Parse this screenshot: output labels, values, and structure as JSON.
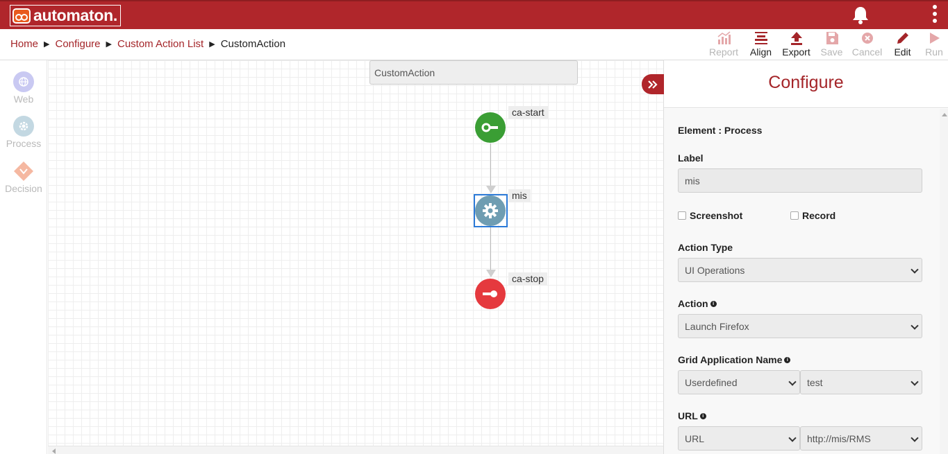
{
  "app": {
    "logo_text": "automaton."
  },
  "breadcrumb": {
    "home": "Home",
    "configure": "Configure",
    "list": "Custom Action List",
    "current": "CustomAction",
    "sep": "▶"
  },
  "toolbar": {
    "report": "Report",
    "align": "Align",
    "export": "Export",
    "save": "Save",
    "cancel": "Cancel",
    "edit": "Edit",
    "run": "Run"
  },
  "palette": {
    "web": "Web",
    "process": "Process",
    "decision": "Decision"
  },
  "canvas": {
    "title": "CustomAction",
    "nodes": {
      "start": "ca-start",
      "process": "mis",
      "stop": "ca-stop"
    }
  },
  "panel": {
    "title": "Configure",
    "element_line": "Element : Process",
    "label_label": "Label",
    "label_value": "mis",
    "screenshot": "Screenshot",
    "record": "Record",
    "action_type_label": "Action Type",
    "action_type_value": "UI Operations",
    "action_label": "Action",
    "action_value": "Launch Firefox",
    "grid_label": "Grid Application Name",
    "grid_mode": "Userdefined",
    "grid_value": "test",
    "url_label": "URL",
    "url_mode": "URL",
    "url_value": "http://mis/RMS"
  },
  "colors": {
    "brand": "#b0262b",
    "start": "#3a9e34",
    "process": "#6f9db2",
    "stop": "#e5393e",
    "selection": "#2b7ad8"
  }
}
